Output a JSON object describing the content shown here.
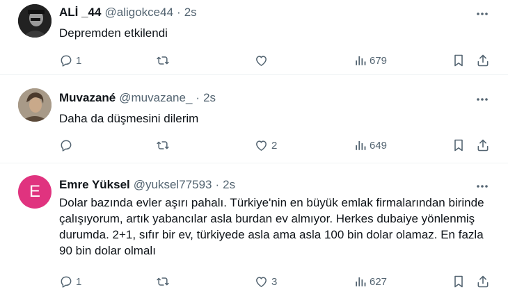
{
  "tweets": [
    {
      "name": "ALİ _44",
      "handle": "@aligokce44",
      "separator": "·",
      "time": "2s",
      "text": "Depremden etkilendi",
      "replies": "1",
      "retweets": "",
      "likes": "",
      "views": "679"
    },
    {
      "name": "Muvazané",
      "handle": "@muvazane_",
      "separator": "·",
      "time": "2s",
      "text": "Daha da düşmesini dilerim",
      "replies": "",
      "retweets": "",
      "likes": "2",
      "views": "649"
    },
    {
      "name": "Emre Yüksel",
      "handle": "@yuksel77593",
      "separator": "·",
      "time": "2s",
      "avatar_letter": "E",
      "text": "Dolar bazında evler aşırı pahalı. Türkiye'nin en büyük emlak firmalarından birinde çalışıyorum, artık yabancılar asla burdan ev almıyor. Herkes dubaiye yönlenmiş durumda. 2+1, sıfır bir ev, türkiyede asla ama asla 100 bin dolar olamaz. En fazla 90 bin dolar olmalı",
      "replies": "1",
      "retweets": "",
      "likes": "3",
      "views": "627"
    }
  ],
  "colors": {
    "text": "#0f1419",
    "secondary": "#536471",
    "divider": "#eff3f4",
    "avatar3": "#e0337f"
  },
  "icons": [
    "more-icon",
    "reply-icon",
    "retweet-icon",
    "like-icon",
    "views-icon",
    "bookmark-icon",
    "share-icon"
  ]
}
